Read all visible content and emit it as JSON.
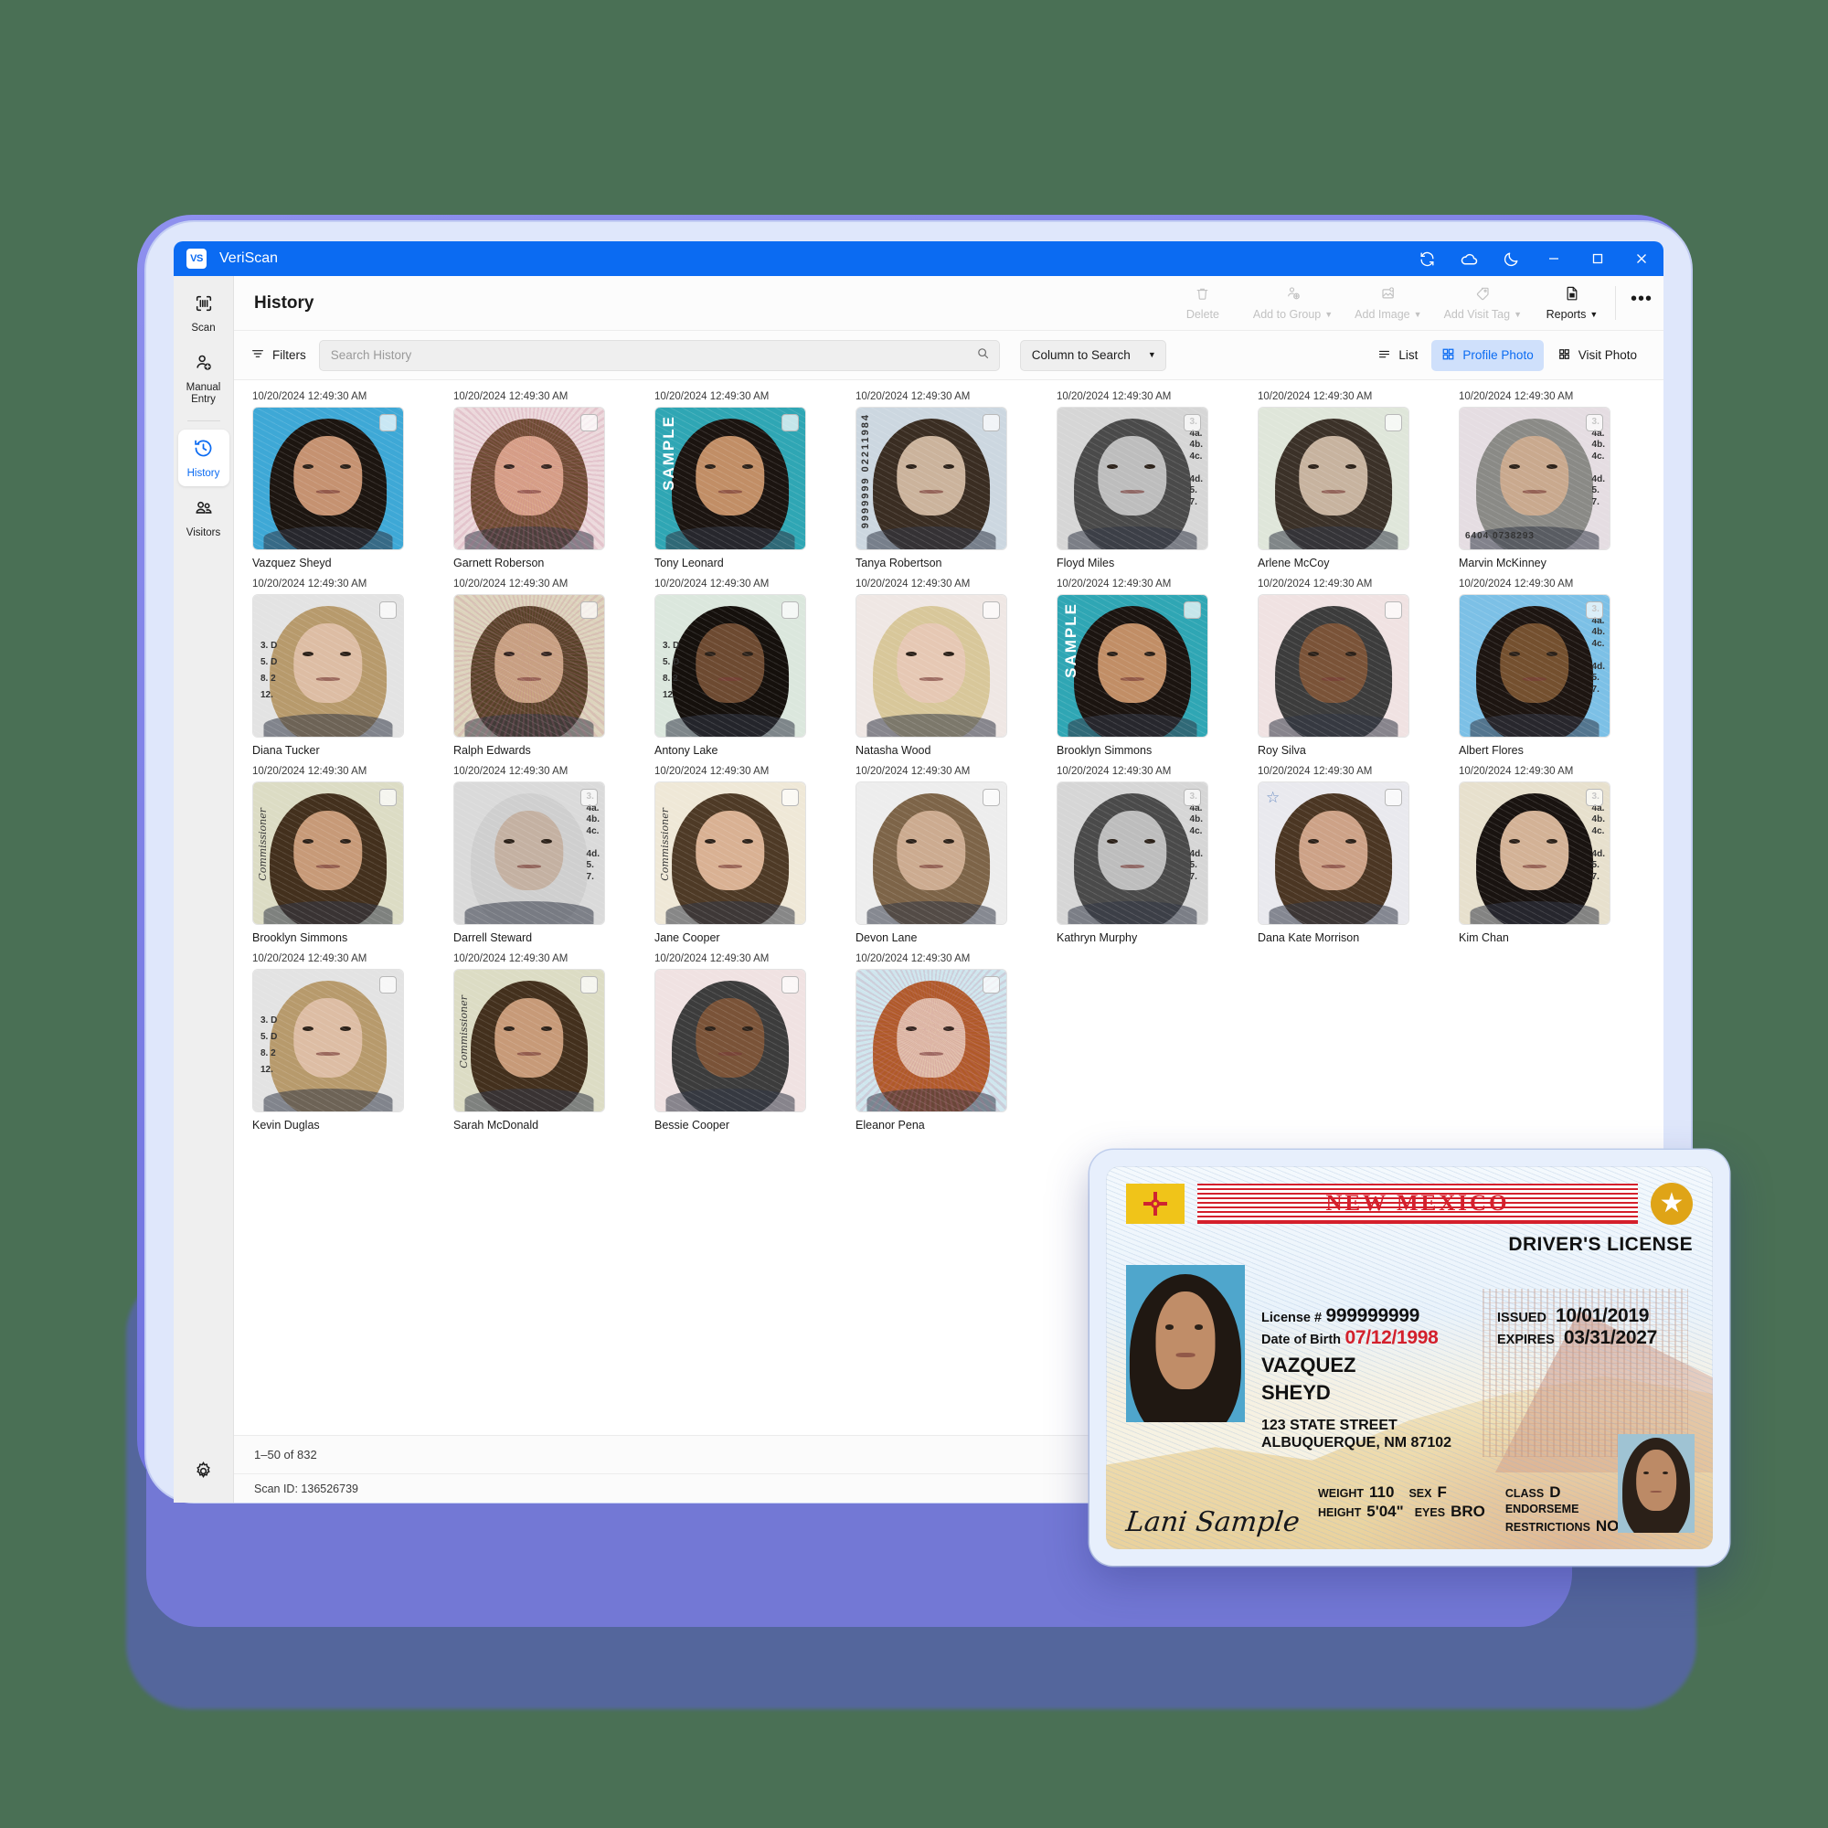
{
  "window": {
    "app_title": "VeriScan",
    "logo_text": "VS",
    "controls": [
      {
        "name": "sync-icon",
        "label": "Sync"
      },
      {
        "name": "cloud-icon",
        "label": "Cloud"
      },
      {
        "name": "moon-icon",
        "label": "Dark mode"
      },
      {
        "name": "minimize-icon",
        "label": "Minimize"
      },
      {
        "name": "maximize-icon",
        "label": "Maximize"
      },
      {
        "name": "close-icon",
        "label": "Close"
      }
    ]
  },
  "sidebar": {
    "items": [
      {
        "label": "Scan",
        "icon": "barcode-scan-icon",
        "active": false
      },
      {
        "label": "Manual Entry",
        "icon": "person-add-icon",
        "active": false
      },
      {
        "label": "History",
        "icon": "history-clock-icon",
        "active": true
      },
      {
        "label": "Visitors",
        "icon": "people-icon",
        "active": false
      }
    ],
    "settings_icon": "gear-icon"
  },
  "header": {
    "title": "History",
    "tools": [
      {
        "label": "Delete",
        "icon": "trash-icon",
        "disabled": true,
        "caret": false
      },
      {
        "label": "Add to Group",
        "icon": "person-group-add-icon",
        "disabled": true,
        "caret": true
      },
      {
        "label": "Add Image",
        "icon": "image-add-icon",
        "disabled": true,
        "caret": true
      },
      {
        "label": "Add Visit Tag",
        "icon": "tag-icon",
        "disabled": true,
        "caret": true
      },
      {
        "label": "Reports",
        "icon": "report-document-icon",
        "disabled": false,
        "caret": true
      }
    ],
    "overflow_label": "•••"
  },
  "filterbar": {
    "filters_label": "Filters",
    "filters_icon": "filter-icon",
    "search_value": "",
    "search_placeholder": "Search History",
    "search_icon": "search-icon",
    "column_select_label": "Column to Search",
    "views": [
      {
        "label": "List",
        "icon": "list-icon",
        "active": false
      },
      {
        "label": "Profile Photo",
        "icon": "grid-icon",
        "active": true
      },
      {
        "label": "Visit Photo",
        "icon": "grid-small-icon",
        "active": false
      }
    ]
  },
  "grid": {
    "timestamp": "10/20/2024 12:49:30 AM",
    "cards": [
      {
        "name": "Vazquez Sheyd",
        "timestamp": "10/20/2024 12:49:30 AM",
        "style": "portrait-blue"
      },
      {
        "name": "Garnett Roberson",
        "timestamp": "10/20/2024 12:49:30 AM",
        "style": "doc-pink"
      },
      {
        "name": "Tony Leonard",
        "timestamp": "10/20/2024 12:49:30 AM",
        "style": "doc-teal-sample"
      },
      {
        "name": "Tanya Robertson",
        "timestamp": "10/20/2024 12:49:30 AM",
        "style": "doc-bluegray"
      },
      {
        "name": "Floyd Miles",
        "timestamp": "10/20/2024 12:49:30 AM",
        "style": "doc-gray"
      },
      {
        "name": "Arlene McCoy",
        "timestamp": "10/20/2024 12:49:30 AM",
        "style": "doc-green"
      },
      {
        "name": "Marvin McKinney",
        "timestamp": "10/20/2024 12:49:30 AM",
        "style": "doc-pinkgray"
      },
      {
        "name": "Diana Tucker",
        "timestamp": "10/20/2024 12:49:30 AM",
        "style": "doc-lightgray"
      },
      {
        "name": "Ralph Edwards",
        "timestamp": "10/20/2024 12:49:30 AM",
        "style": "doc-tan"
      },
      {
        "name": "Antony Lake",
        "timestamp": "10/20/2024 12:49:30 AM",
        "style": "doc-mint"
      },
      {
        "name": "Natasha Wood",
        "timestamp": "10/20/2024 12:49:30 AM",
        "style": "doc-pale"
      },
      {
        "name": "Brooklyn Simmons",
        "timestamp": "10/20/2024 12:49:30 AM",
        "style": "doc-teal-sample"
      },
      {
        "name": "Roy Silva",
        "timestamp": "10/20/2024 12:49:30 AM",
        "style": "doc-rose"
      },
      {
        "name": "Albert Flores",
        "timestamp": "10/20/2024 12:49:30 AM",
        "style": "doc-bluecard"
      },
      {
        "name": "Brooklyn Simmons",
        "timestamp": "10/20/2024 12:49:30 AM",
        "style": "doc-olive"
      },
      {
        "name": "Darrell Steward",
        "timestamp": "10/20/2024 12:49:30 AM",
        "style": "doc-steel"
      },
      {
        "name": "Jane Cooper",
        "timestamp": "10/20/2024 12:49:30 AM",
        "style": "doc-cream"
      },
      {
        "name": "Devon Lane",
        "timestamp": "10/20/2024 12:49:30 AM",
        "style": "doc-white"
      },
      {
        "name": "Kathryn Murphy",
        "timestamp": "10/20/2024 12:49:30 AM",
        "style": "doc-gray"
      },
      {
        "name": "Dana Kate Morrison",
        "timestamp": "10/20/2024 12:49:30 AM",
        "style": "doc-star"
      },
      {
        "name": "Kim Chan",
        "timestamp": "10/20/2024 12:49:30 AM",
        "style": "doc-sand"
      },
      {
        "name": "Kevin Duglas",
        "timestamp": "10/20/2024 12:49:30 AM",
        "style": "doc-lightgray"
      },
      {
        "name": "Sarah McDonald",
        "timestamp": "10/20/2024 12:49:30 AM",
        "style": "doc-olive"
      },
      {
        "name": "Bessie Cooper",
        "timestamp": "10/20/2024 12:49:30 AM",
        "style": "doc-rose"
      },
      {
        "name": "Eleanor Pena",
        "timestamp": "10/20/2024 12:49:30 AM",
        "style": "doc-cyan"
      }
    ]
  },
  "footer": {
    "pagination": "1–50 of 832",
    "scan_id": "Scan ID: 136526739"
  },
  "license": {
    "state": "NEW MEXICO",
    "doc_type": "DRIVER'S LICENSE",
    "license_number_label": "License #",
    "license_number": "999999999",
    "dob_label": "Date of Birth",
    "dob": "07/12/1998",
    "issued_label": "ISSUED",
    "issued": "10/01/2019",
    "expires_label": "EXPIRES",
    "expires": "03/31/2027",
    "last_name": "VAZQUEZ",
    "first_name": "SHEYD",
    "address_line1": "123 STATE STREET",
    "address_line2": "ALBUQUERQUE, NM 87102",
    "signature": "Lani Sample",
    "weight_label": "WEIGHT",
    "weight": "110",
    "sex_label": "SEX",
    "sex": "F",
    "height_label": "HEIGHT",
    "height": "5'04\"",
    "eyes_label": "EYES",
    "eyes": "BRO",
    "class_label": "CLASS",
    "class": "D",
    "endorsements_label": "ENDORSEME",
    "restrictions_label": "RESTRICTIONS",
    "restrictions": "NONE"
  },
  "colors": {
    "brand_blue": "#0b6bf2",
    "accent_active_bg": "#cfe0fb",
    "device_purple": "#6366d8",
    "license_red": "#d3202c",
    "license_gold": "#dfa417",
    "page_bg": "#4a7055"
  }
}
